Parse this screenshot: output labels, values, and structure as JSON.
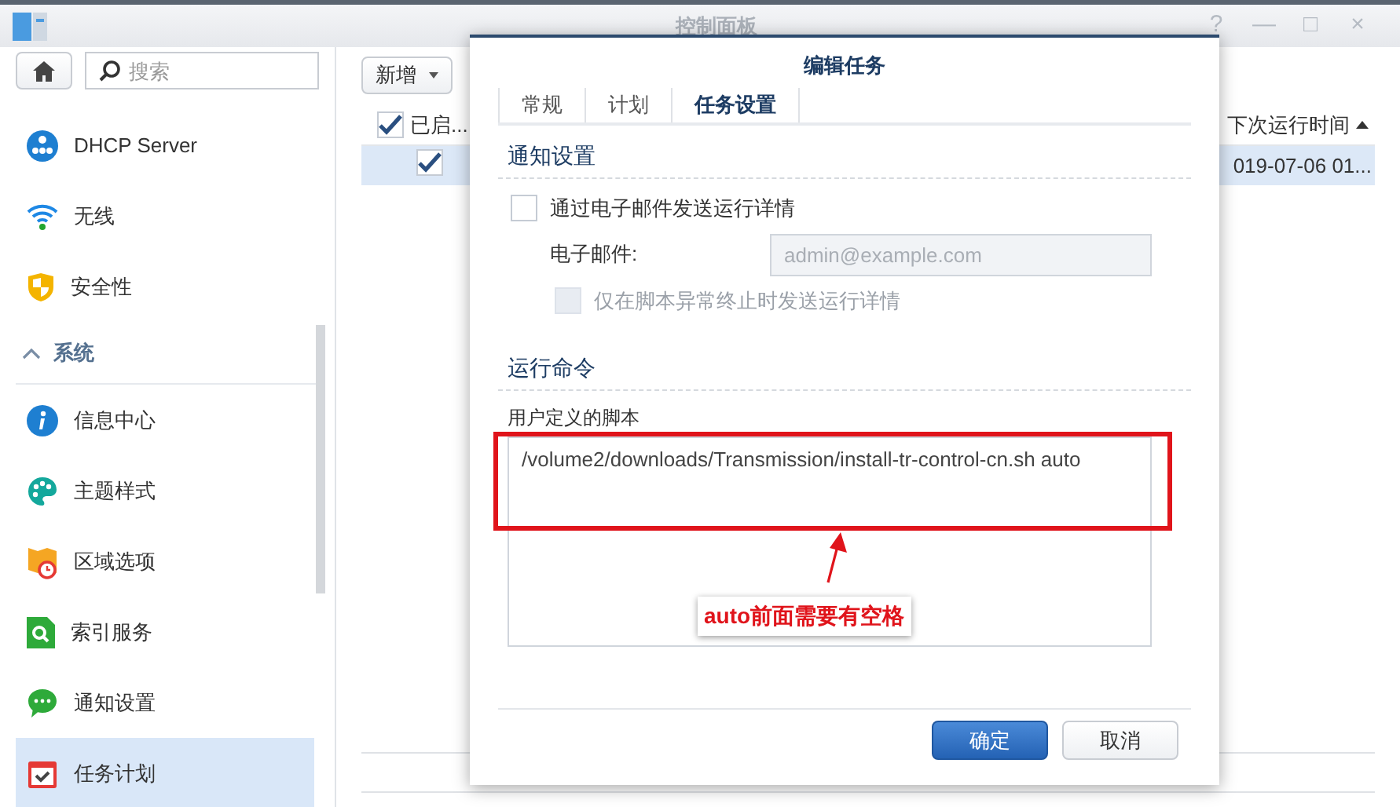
{
  "window": {
    "title": "控制面板",
    "controls": [
      "?",
      "—",
      "□",
      "×"
    ]
  },
  "sidebar": {
    "search": {
      "placeholder": "搜索"
    },
    "items": [
      {
        "kind": "item",
        "label": "DHCP Server",
        "selected": false
      },
      {
        "kind": "item",
        "label": "无线",
        "selected": false
      },
      {
        "kind": "item",
        "label": "安全性",
        "selected": false
      },
      {
        "kind": "section",
        "label": "系统",
        "expanded": true
      },
      {
        "kind": "item",
        "label": "信息中心",
        "selected": false
      },
      {
        "kind": "item",
        "label": "主题样式",
        "selected": false
      },
      {
        "kind": "item",
        "label": "区域选项",
        "selected": false
      },
      {
        "kind": "item",
        "label": "索引服务",
        "selected": false
      },
      {
        "kind": "item",
        "label": "通知设置",
        "selected": false
      },
      {
        "kind": "item",
        "label": "任务计划",
        "selected": true
      }
    ]
  },
  "toolbar": {
    "add_button": "新增"
  },
  "table": {
    "columns": [
      {
        "label": "已启...",
        "checked": true
      },
      {
        "label": "下次运行时间"
      }
    ],
    "rows": [
      {
        "enabled": true,
        "next_run": "019-07-06 01...",
        "selected": true
      }
    ]
  },
  "dialog": {
    "title": "编辑任务",
    "tabs": [
      {
        "label": "常规",
        "selected": false
      },
      {
        "label": "计划",
        "selected": false
      },
      {
        "label": "任务设置",
        "selected": true
      }
    ],
    "notify_section": "通知设置",
    "email_checkbox": {
      "label": "通过电子邮件发送运行详情",
      "checked": false
    },
    "email_field": {
      "label": "电子邮件:",
      "placeholder": "admin@example.com",
      "disabled": true
    },
    "abort_checkbox": {
      "label": "仅在脚本异常终止时发送运行详情",
      "checked": false,
      "disabled": true
    },
    "command_section": "运行命令",
    "script_label": "用户定义的脚本",
    "script_value": "/volume2/downloads/Transmission/install-tr-control-cn.sh auto",
    "buttons": [
      {
        "label": "确定",
        "kind": "primary"
      },
      {
        "label": "取消",
        "kind": "secondary"
      }
    ]
  },
  "annotation": {
    "text": "auto前面需要有空格"
  }
}
